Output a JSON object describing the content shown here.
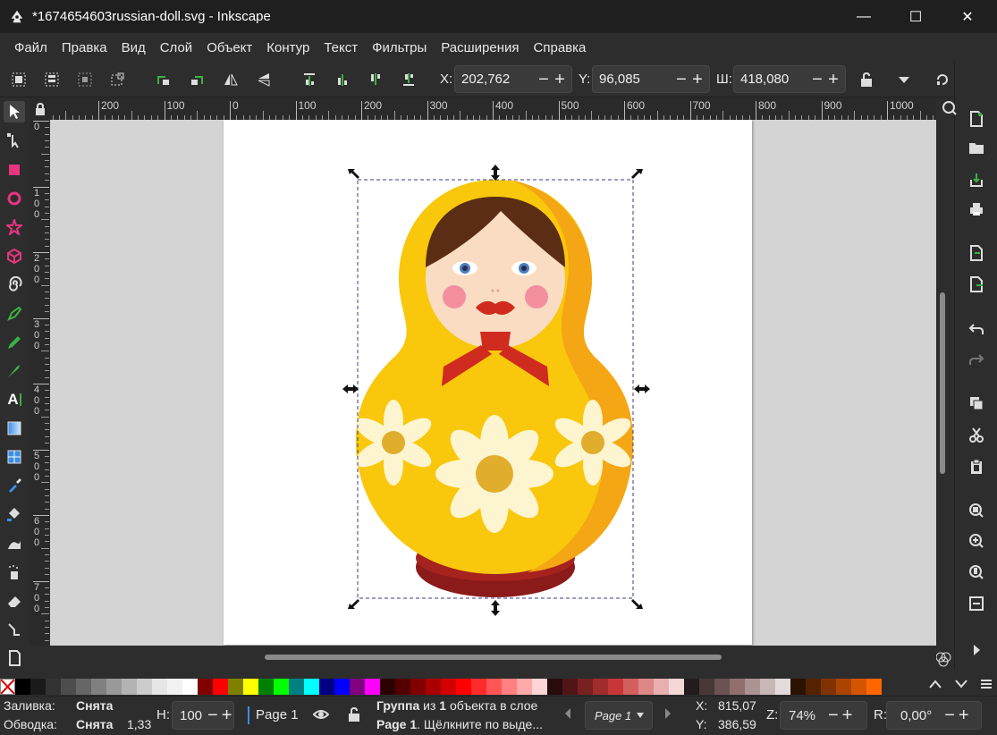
{
  "window": {
    "title": "*1674654603russian-doll.svg - Inkscape",
    "minimize": "—",
    "maximize": "☐",
    "close": "✕"
  },
  "menu": [
    "Файл",
    "Правка",
    "Вид",
    "Слой",
    "Объект",
    "Контур",
    "Текст",
    "Фильтры",
    "Расширения",
    "Справка"
  ],
  "controls": {
    "x_label": "X:",
    "x_value": "202,762",
    "y_label": "Y:",
    "y_value": "96,085",
    "w_label": "Ш:",
    "w_value": "418,080",
    "minus": "−",
    "plus": "+"
  },
  "ruler": {
    "h_labels": [
      "200",
      "100",
      "0",
      "100",
      "200",
      "300",
      "400",
      "500",
      "600",
      "700",
      "800",
      "900",
      "1000"
    ],
    "v_labels": [
      "0",
      "1\n0\n0",
      "2\n0\n0",
      "3\n0\n0",
      "4\n0\n0",
      "5\n0\n0",
      "6\n0\n0",
      "7\n0\n0"
    ]
  },
  "palette_colors": [
    "#000000",
    "#1a1a1a",
    "#333333",
    "#4d4d4d",
    "#666666",
    "#808080",
    "#999999",
    "#b3b3b3",
    "#cccccc",
    "#e6e6e6",
    "#f2f2f2",
    "#ffffff",
    "#800000",
    "#ff0000",
    "#808000",
    "#ffff00",
    "#008000",
    "#00ff00",
    "#008080",
    "#00ffff",
    "#000080",
    "#0000ff",
    "#800080",
    "#ff00ff",
    "#2b0000",
    "#550000",
    "#800000",
    "#aa0000",
    "#d40000",
    "#ff0000",
    "#ff2a2a",
    "#ff5555",
    "#ff8080",
    "#ffaaaa",
    "#ffd5d5",
    "#280b0b",
    "#501616",
    "#782121",
    "#a02c2c",
    "#c83737",
    "#d35f5f",
    "#de8787",
    "#e9afaf",
    "#f4d7d7",
    "#241c1c",
    "#483737",
    "#6c5353",
    "#916f6f",
    "#ac9393",
    "#c8b7b7",
    "#e3dbdb",
    "#2b1100",
    "#552200",
    "#803300",
    "#aa4400",
    "#d45500",
    "#ff6600"
  ],
  "status": {
    "fill_label": "Заливка:",
    "fill_value": "Снята",
    "stroke_label": "Обводка:",
    "stroke_value": "Снята",
    "stroke_width": "1,33",
    "opacity_label": "Н:",
    "opacity_value": "100",
    "page_label": "Page 1",
    "message_line1_a": "Группа",
    "message_line1_b": " из ",
    "message_line1_c": "1",
    "message_line1_d": " объекта в слое",
    "message_line2_a": "Page 1",
    "message_line2_b": ". Щёлкните по выде...",
    "page_select": "Page 1",
    "cursor_x_label": "X:",
    "cursor_x": "815,07",
    "cursor_y_label": "Y:",
    "cursor_y": "386,59",
    "zoom_label": "Z:",
    "zoom_value": "74%",
    "rotation_label": "R:",
    "rotation_value": "0,00°"
  },
  "colors": {
    "doll_yellow": "#f9c70c",
    "doll_orange": "#f5a614",
    "doll_base": "#8b1a1a",
    "hair": "#5a2d14",
    "face": "#f9dcc2",
    "scarf": "#d02b1f",
    "flower": "#fdf5cf",
    "flower_center": "#e0ad2d",
    "accent": "#0078d4"
  }
}
